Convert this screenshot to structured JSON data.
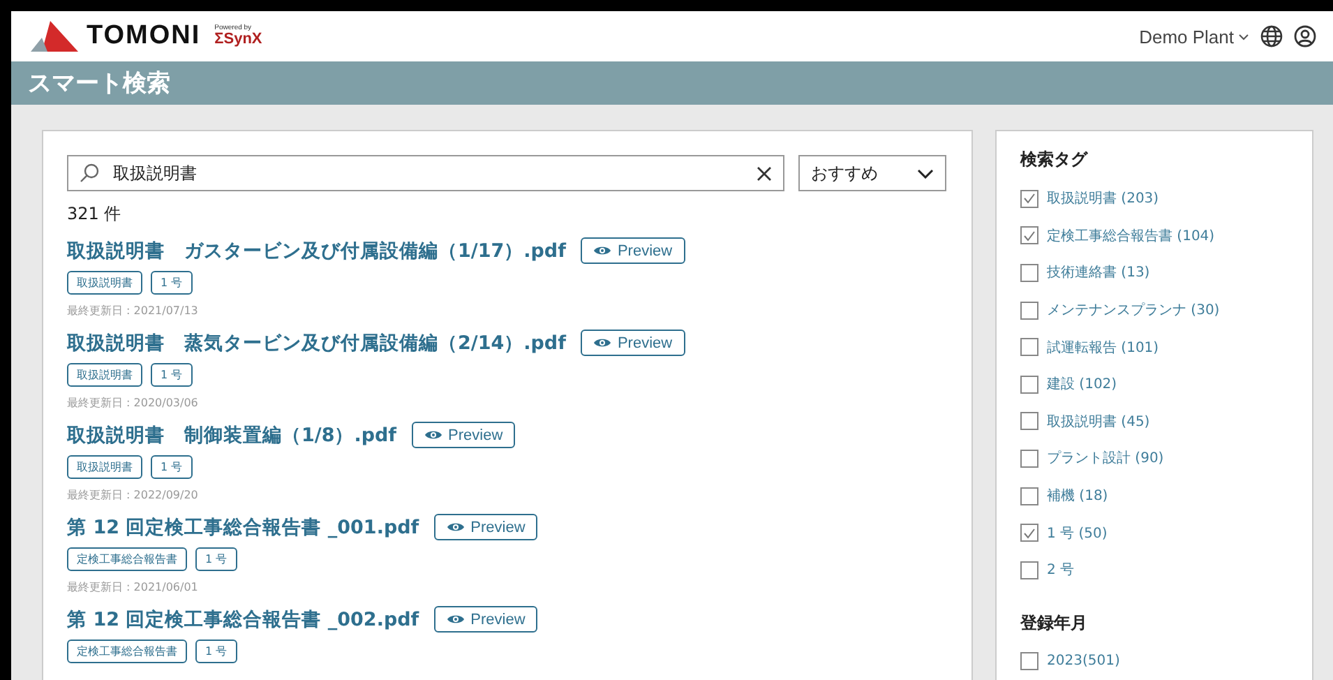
{
  "header": {
    "brand": "TOMONI",
    "powered_by": "Powered by",
    "partner": "ΣSynX",
    "plant": "Demo Plant"
  },
  "page_title": "スマート検索",
  "search": {
    "value": "取扱説明書",
    "sort": "おすすめ"
  },
  "result_count": "321 件",
  "results": [
    {
      "title": "取扱説明書　ガスタービン及び付属設備編（1/17）.pdf",
      "preview": "Preview",
      "tags": [
        "取扱説明書",
        "1 号"
      ],
      "updated": "最終更新日 : 2021/07/13"
    },
    {
      "title": "取扱説明書　蒸気タービン及び付属設備編（2/14）.pdf",
      "preview": "Preview",
      "tags": [
        "取扱説明書",
        "1 号"
      ],
      "updated": "最終更新日 : 2020/03/06"
    },
    {
      "title": "取扱説明書　制御装置編（1/8）.pdf",
      "preview": "Preview",
      "tags": [
        "取扱説明書",
        "1 号"
      ],
      "updated": "最終更新日 : 2022/09/20"
    },
    {
      "title": "第 12 回定検工事総合報告書 _001.pdf",
      "preview": "Preview",
      "tags": [
        "定検工事総合報告書",
        "1 号"
      ],
      "updated": "最終更新日 : 2021/06/01"
    },
    {
      "title": "第 12 回定検工事総合報告書 _002.pdf",
      "preview": "Preview",
      "tags": [
        "定検工事総合報告書",
        "1 号"
      ]
    }
  ],
  "filters": [
    {
      "heading": "検索タグ",
      "options": [
        {
          "label": "取扱説明書 (203)",
          "checked": true
        },
        {
          "label": "定検工事総合報告書 (104)",
          "checked": true
        },
        {
          "label": "技術連絡書 (13)",
          "checked": false
        },
        {
          "label": "メンテナンスプランナ (30)",
          "checked": false
        },
        {
          "label": "試運転報告 (101)",
          "checked": false
        },
        {
          "label": "建設 (102)",
          "checked": false
        },
        {
          "label": "取扱説明書 (45)",
          "checked": false
        },
        {
          "label": "プラント設計 (90)",
          "checked": false
        },
        {
          "label": "補機 (18)",
          "checked": false
        },
        {
          "label": "1 号 (50)",
          "checked": true
        },
        {
          "label": "2 号",
          "checked": false
        }
      ]
    },
    {
      "heading": "登録年月",
      "options": [
        {
          "label": "2023(501)",
          "checked": false
        }
      ]
    }
  ]
}
